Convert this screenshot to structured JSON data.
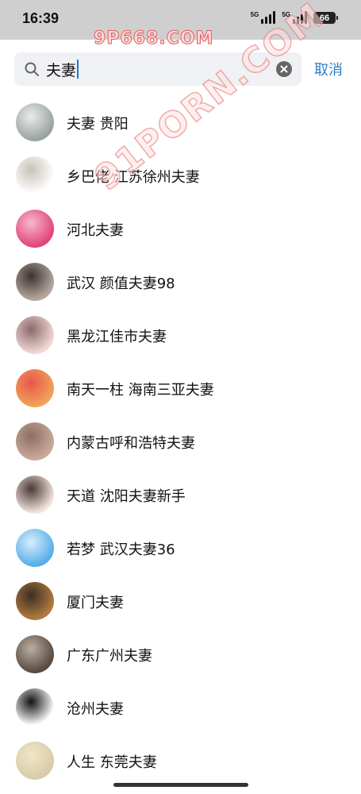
{
  "status_bar": {
    "time": "16:39",
    "network1": "5G",
    "network2": "5G",
    "battery": "66"
  },
  "watermarks": {
    "top": "9P668.COM",
    "diagonal": "91PORN.COM"
  },
  "search": {
    "query": "夫妻",
    "cancel_label": "取消"
  },
  "results": [
    {
      "name": "夫妻 贵阳",
      "avatar_color": "#9aa39e",
      "avatar_accent": "#e9ecea"
    },
    {
      "name": "乡巴佬 江苏徐州夫妻",
      "avatar_color": "#ffffff",
      "avatar_accent": "#c8c2b8"
    },
    {
      "name": "河北夫妻",
      "avatar_color": "#e0457a",
      "avatar_accent": "#f7b7cf"
    },
    {
      "name": "武汉 颜值夫妻98",
      "avatar_color": "#b5a79e",
      "avatar_accent": "#3b3330"
    },
    {
      "name": "黑龙江佳市夫妻",
      "avatar_color": "#f2d7d7",
      "avatar_accent": "#8a6a6a"
    },
    {
      "name": "南天一柱 海南三亚夫妻",
      "avatar_color": "#f0a25a",
      "avatar_accent": "#e8574c"
    },
    {
      "name": "内蒙古呼和浩特夫妻",
      "avatar_color": "#c9a99a",
      "avatar_accent": "#8c6f63"
    },
    {
      "name": "天道 沈阳夫妻新手",
      "avatar_color": "#f3e3dc",
      "avatar_accent": "#4a3a36"
    },
    {
      "name": "若梦 武汉夫妻36",
      "avatar_color": "#57aee8",
      "avatar_accent": "#d8eefb"
    },
    {
      "name": "厦门夫妻",
      "avatar_color": "#b07a3e",
      "avatar_accent": "#3a2e24"
    },
    {
      "name": "广东广州夫妻",
      "avatar_color": "#5a4a40",
      "avatar_accent": "#b9ada2"
    },
    {
      "name": "沧州夫妻",
      "avatar_color": "#ffffff",
      "avatar_accent": "#111111"
    },
    {
      "name": "人生 东莞夫妻",
      "avatar_color": "#d8cba8",
      "avatar_accent": "#f0e6c8"
    }
  ]
}
